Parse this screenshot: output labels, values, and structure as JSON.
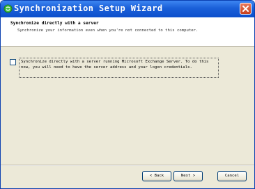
{
  "window": {
    "title": "Synchronization Setup Wizard",
    "close_icon": "close-icon",
    "app_icon": "sync-icon"
  },
  "header": {
    "title": "Synchronize directly with a server",
    "subtitle": "Synchronize your information even when you're not connected to this computer."
  },
  "option": {
    "checked": false,
    "label": "Synchronize directly with a server running Microsoft Exchange Server.  To do this now, you will need to have the server address and your logon credentials."
  },
  "buttons": {
    "back": "< Back",
    "next": "Next >",
    "cancel": "Cancel"
  },
  "colors": {
    "titlebar": "#1a5fd8",
    "window_face": "#ece9d8",
    "close_button": "#c9401d"
  }
}
